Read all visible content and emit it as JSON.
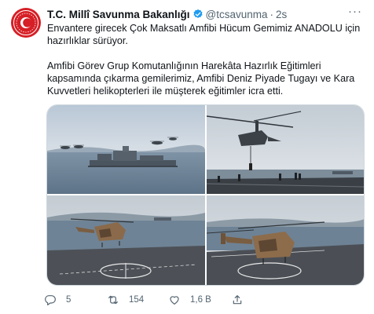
{
  "tweet": {
    "author_name": "T.C. Millî Savunma Bakanlığı",
    "handle": "@tcsavunma",
    "separator": "·",
    "time": "2s",
    "text_line1": "Envantere girecek Çok Maksatlı Amfibi Hücum Gemimiz ANADOLU için hazırlıklar sürüyor.",
    "text_line2": "Amfibi Görev Grup Komutanlığının Harekâta Hazırlık Eğitimleri kapsamında çıkarma gemilerimiz, Amfibi Deniz Piyade Tugayı ve Kara Kuvvetleri helikopterleri ile müşterek eğitimler icra etti."
  },
  "actions": {
    "reply_count": "5",
    "retweet_count": "154",
    "like_count": "1,6 B"
  },
  "colors": {
    "text": "#0f1419",
    "secondary": "#536471",
    "verified": "#1d9bf0",
    "avatar": "#d61f26"
  },
  "icons": [
    "ministry-logo",
    "verified-icon",
    "more-icon",
    "reply-icon",
    "retweet-icon",
    "like-icon",
    "share-icon"
  ]
}
